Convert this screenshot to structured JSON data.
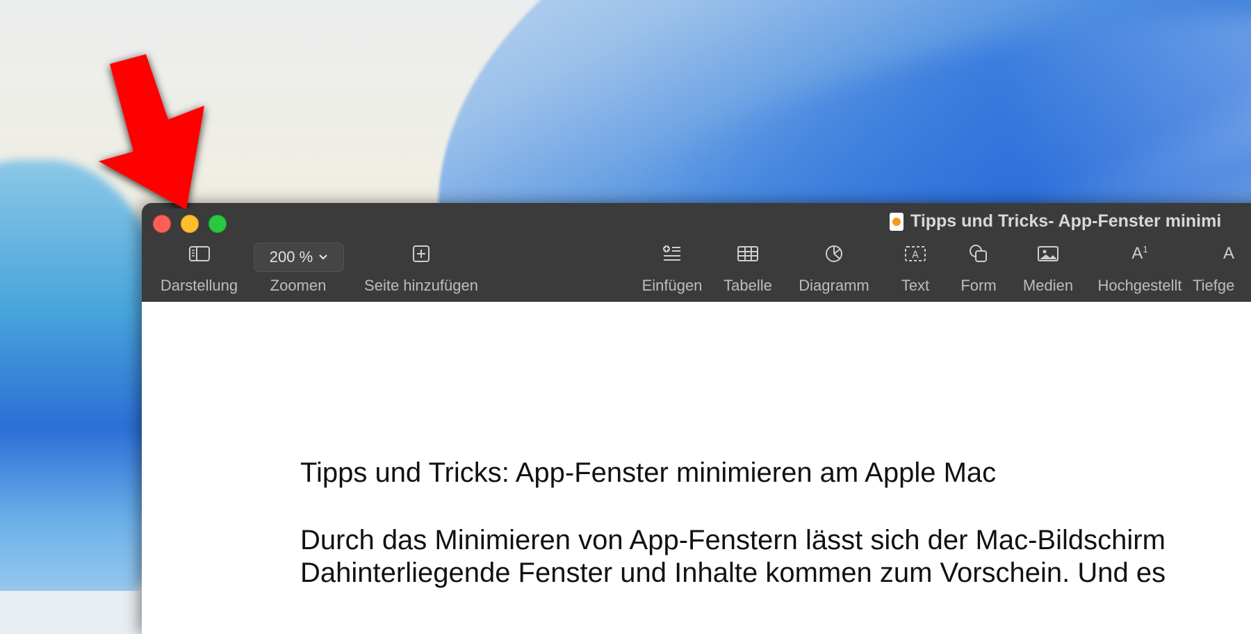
{
  "window": {
    "title": "Tipps und Tricks- App-Fenster minimi",
    "controls": {
      "close_icon": "close-icon",
      "minimize_icon": "minimize-icon",
      "zoom_icon": "fullscreen-icon"
    }
  },
  "toolbar": {
    "darstellung": "Darstellung",
    "zoom_value": "200 %",
    "zoom_label": "Zoomen",
    "add_page": "Seite hinzufügen",
    "einfuegen": "Einfügen",
    "tabelle": "Tabelle",
    "diagramm": "Diagramm",
    "text": "Text",
    "form": "Form",
    "medien": "Medien",
    "hochgestellt": "Hochgestellt",
    "hoch_icon_text": "A",
    "hoch_sup": "1",
    "tiefgestellt": "Tiefge",
    "tief_icon_text": "A"
  },
  "document": {
    "title": "Tipps und Tricks: App-Fenster minimieren am Apple Mac",
    "paragraph_line1": "Durch das Minimieren von App-Fenstern lässt sich der Mac-Bildschirm",
    "paragraph_line2": "Dahinterliegende Fenster und Inhalte kommen zum Vorschein. Und es"
  },
  "annotation": {
    "arrow_color": "#ff0000",
    "points_to": "minimize-button"
  },
  "colors": {
    "toolbar_bg": "#3b3b3b",
    "close": "#fe5f57",
    "minimize": "#febc2e",
    "zoom": "#28c840"
  }
}
